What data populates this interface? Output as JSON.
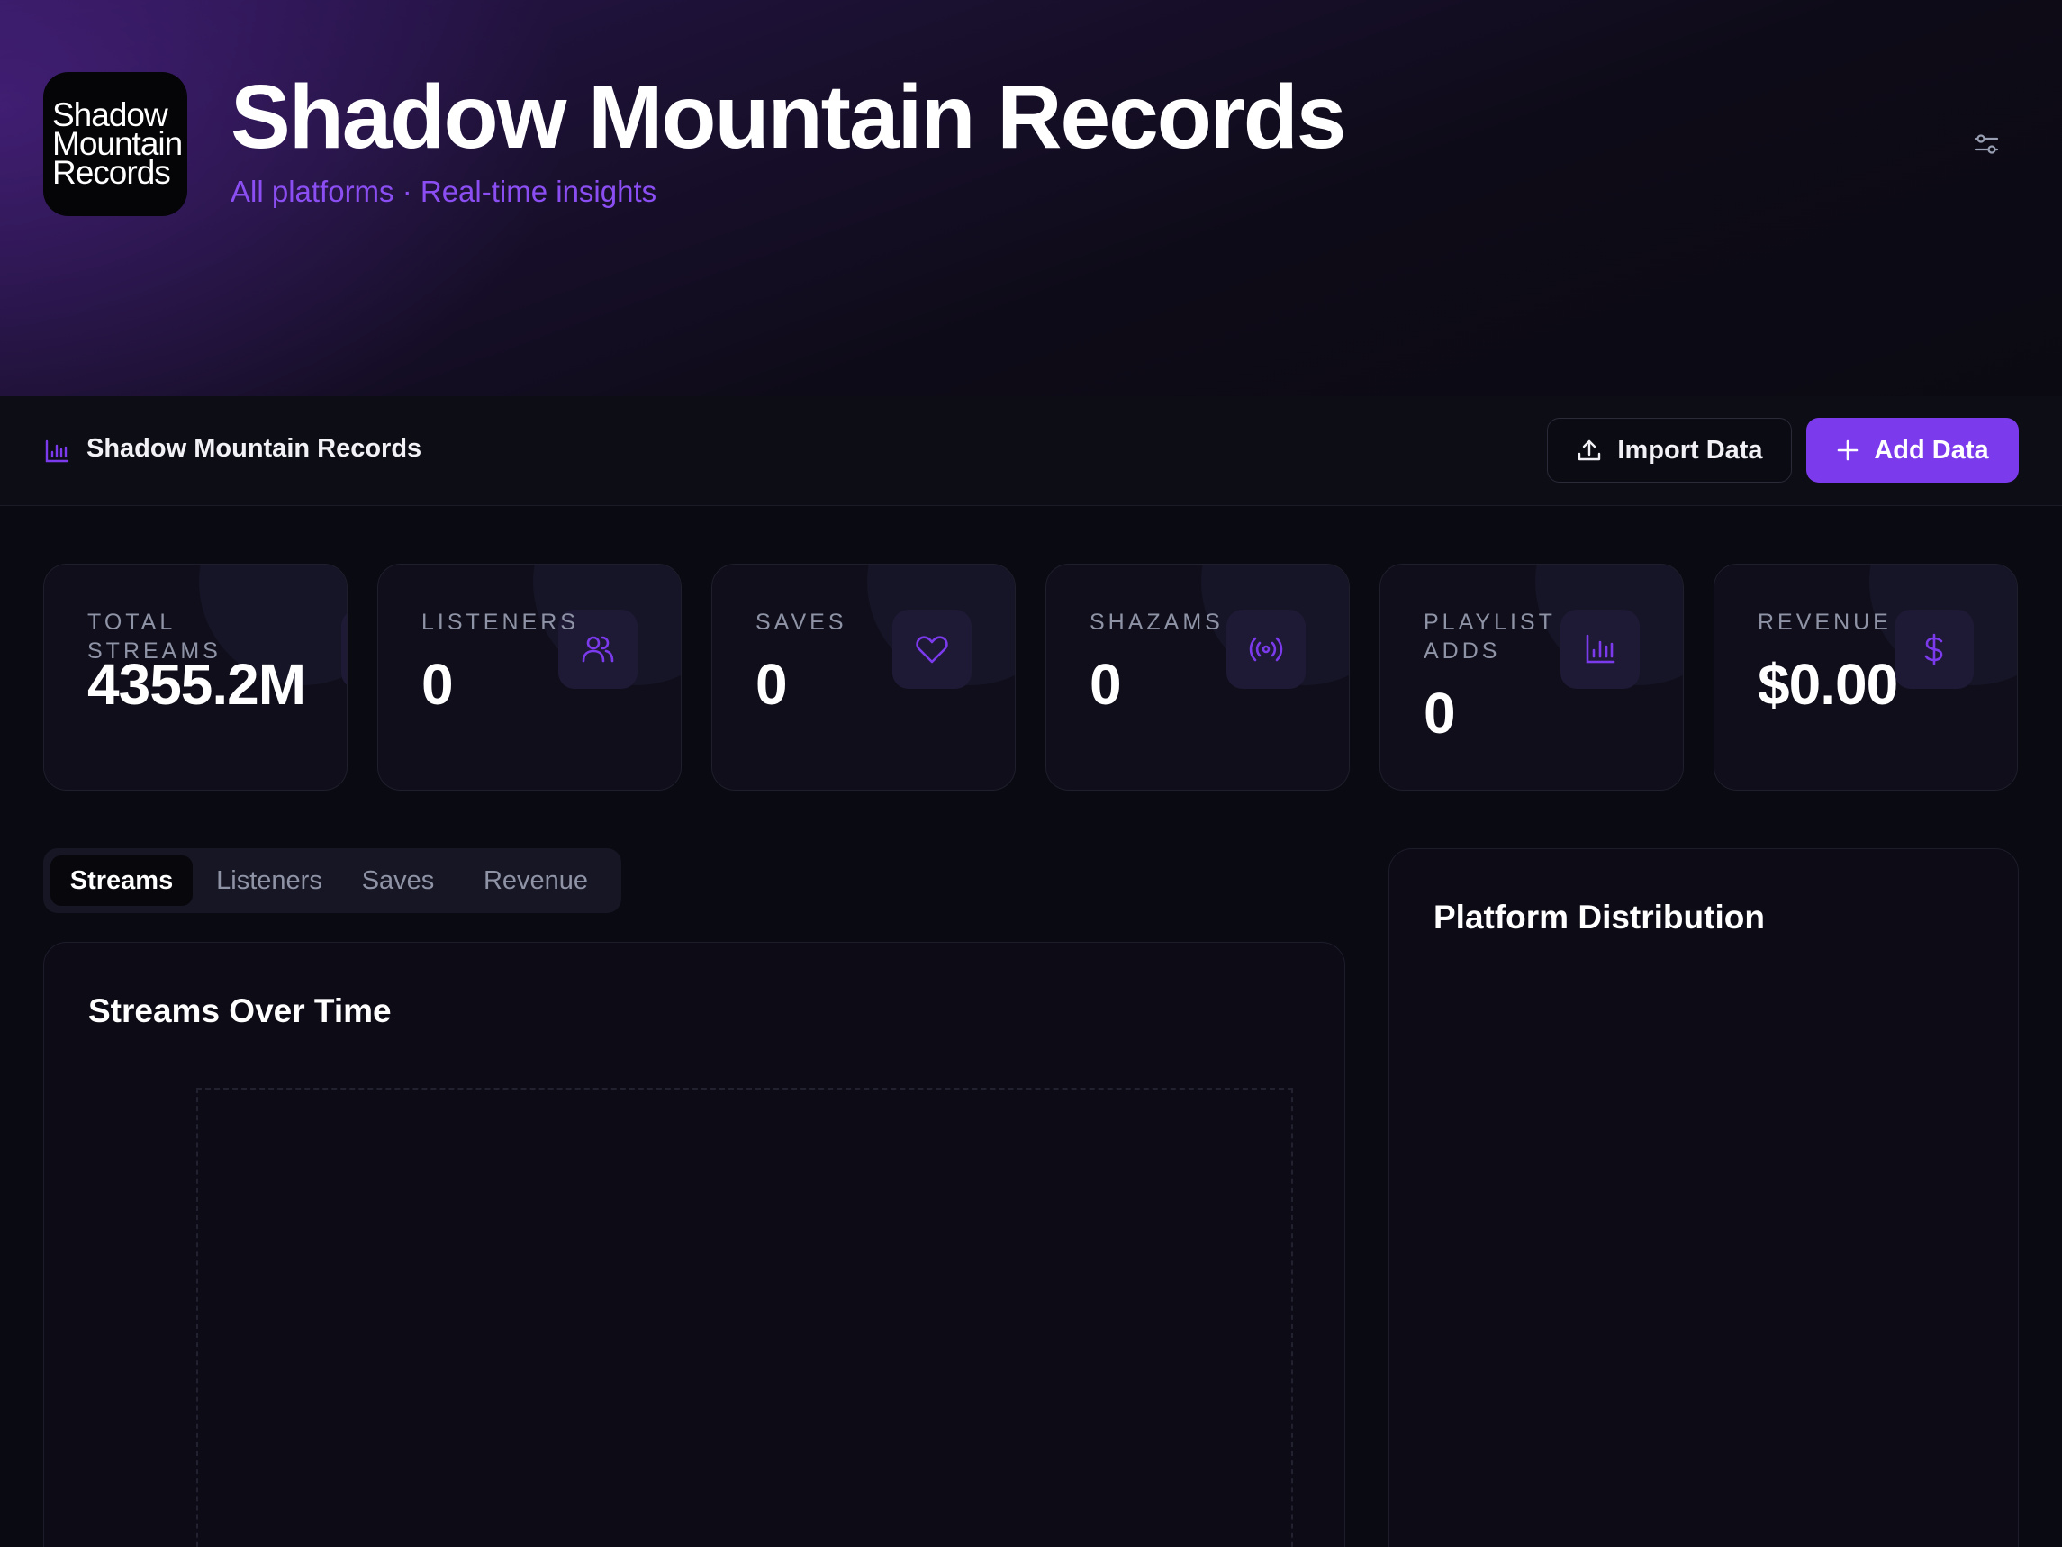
{
  "hero": {
    "logo_lines": [
      "Shadow",
      "Mountain",
      "Records"
    ],
    "title": "Shadow Mountain Records",
    "subtitle": "All platforms · Real-time insights"
  },
  "toolbar": {
    "title": "Shadow Mountain Records",
    "import_label": "Import Data",
    "add_label": "Add Data"
  },
  "stats": [
    {
      "label": "TOTAL STREAMS",
      "value": "4355.2M",
      "icon": "bar-chart-icon"
    },
    {
      "label": "LISTENERS",
      "value": "0",
      "icon": "users-icon"
    },
    {
      "label": "SAVES",
      "value": "0",
      "icon": "heart-icon"
    },
    {
      "label": "SHAZAMS",
      "value": "0",
      "icon": "radio-broadcast-icon"
    },
    {
      "label": "PLAYLIST ADDS",
      "value": "0",
      "icon": "bar-chart-icon"
    },
    {
      "label": "REVENUE",
      "value": "$0.00",
      "icon": "dollar-icon"
    }
  ],
  "tabs": [
    {
      "label": "Streams",
      "active": true
    },
    {
      "label": "Listeners",
      "active": false
    },
    {
      "label": "Saves",
      "active": false
    },
    {
      "label": "Revenue",
      "active": false
    }
  ],
  "chart": {
    "title": "Streams Over Time"
  },
  "platform": {
    "title": "Platform Distribution"
  },
  "colors": {
    "accent": "#7c3aed",
    "accent_text": "#8b4ef2",
    "background": "#0a0a12"
  }
}
